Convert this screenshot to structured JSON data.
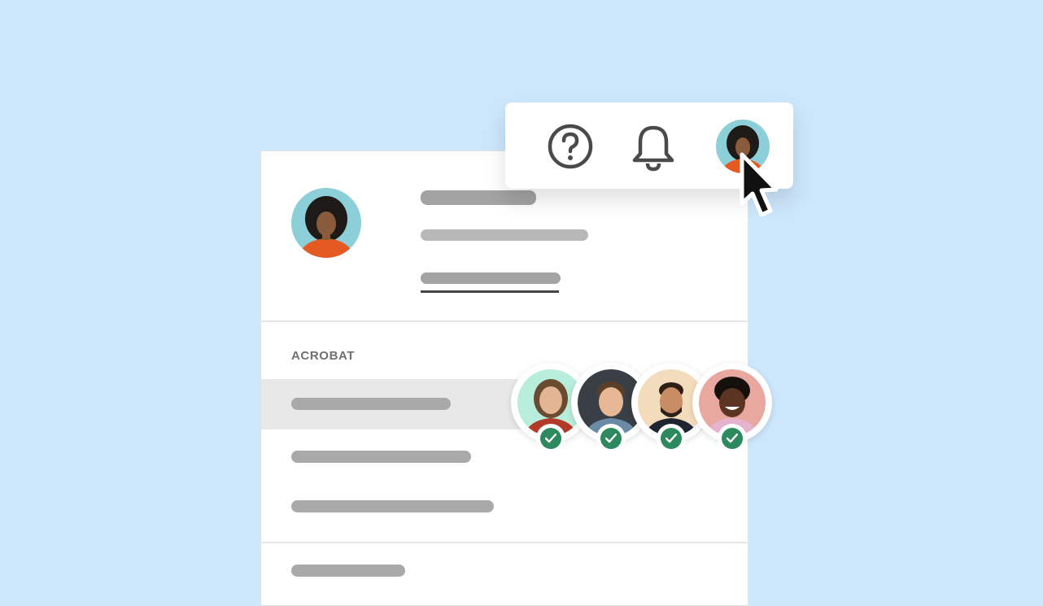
{
  "menu": {
    "section_label": "ACROBAT"
  },
  "profile": {
    "avatar": "woman-curly-hair-orange-sweater"
  },
  "toolbar": {
    "icons": [
      "help-icon",
      "bell-icon",
      "user-avatar"
    ]
  },
  "collaborators": [
    {
      "avatar": "woman-long-hair",
      "status": "checked"
    },
    {
      "avatar": "man-smiling-dark-background",
      "status": "checked"
    },
    {
      "avatar": "man-beard-beige-background",
      "status": "checked"
    },
    {
      "avatar": "man-afro-pink-background",
      "status": "checked"
    }
  ],
  "colors": {
    "background": "#cce6fc",
    "check_green": "#2d8a5f",
    "placeholder_bar": "#a9a9a9"
  }
}
